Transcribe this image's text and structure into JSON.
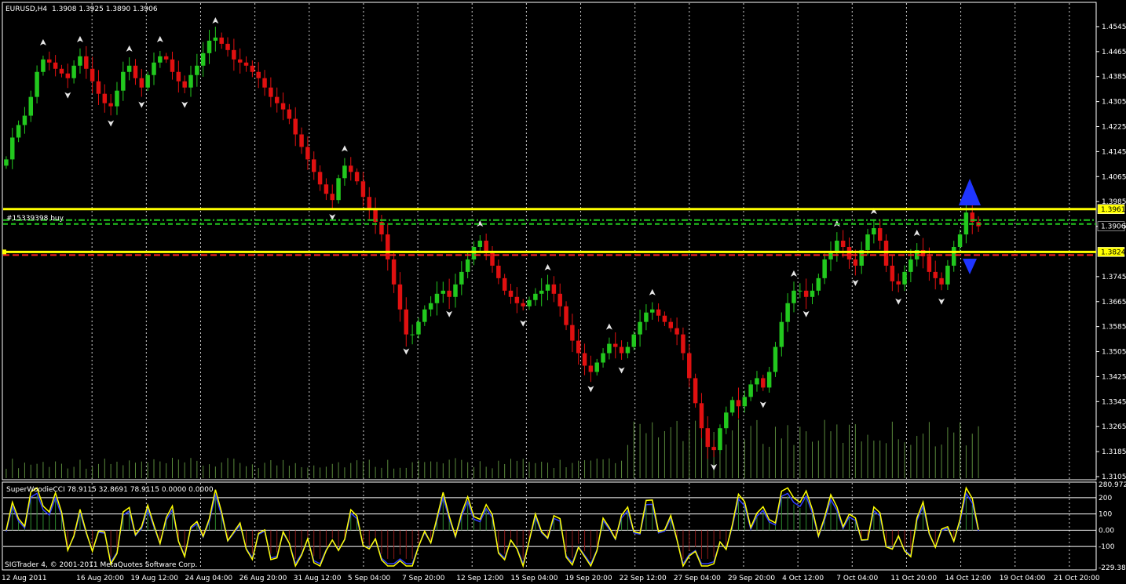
{
  "app": {
    "name": "SIGTrader 4",
    "copyright": "SIGTrader 4, © 2001-2011 MetaQuotes Software Corp."
  },
  "chart_header": {
    "symbol_tf": "EURUSD,H4",
    "ohlc": "1.3908 1.3925 1.3890 1.3906"
  },
  "order_label": "#15339398 buy",
  "price_axis": {
    "ticks": [
      "1.4545",
      "1.4465",
      "1.4385",
      "1.4305",
      "1.4225",
      "1.4145",
      "1.4065",
      "1.3985",
      "1.3906",
      "1.3745",
      "1.3665",
      "1.3585",
      "1.3505",
      "1.3425",
      "1.3345",
      "1.3265",
      "1.3185",
      "1.3105"
    ],
    "markers": {
      "upper": "1.3961",
      "current": "1.3906",
      "lower": "1.3824"
    }
  },
  "time_axis": [
    "12 Aug 2011",
    "16 Aug 20:00",
    "19 Aug 12:00",
    "24 Aug 04:00",
    "26 Aug 20:00",
    "31 Aug 12:00",
    "5 Sep 04:00",
    "7 Sep 20:00",
    "12 Sep 12:00",
    "15 Sep 04:00",
    "19 Sep 20:00",
    "22 Sep 12:00",
    "27 Sep 04:00",
    "29 Sep 20:00",
    "4 Oct 12:00",
    "7 Oct 04:00",
    "11 Oct 20:00",
    "14 Oct 12:00",
    "19 Oct 04:00",
    "21 Oct 20:00"
  ],
  "indicator": {
    "header": "SuperWoodieCCI 78.9115 32.8691 78.9115 0.0000 0.0000",
    "axis": [
      "280.972",
      "200",
      "100",
      "0.00",
      "-100",
      "-229.38"
    ]
  },
  "colors": {
    "bull": "#22c81e",
    "bear": "#e01010",
    "level": "#ffff00",
    "green_line": "#22c81e",
    "red_line": "#ff2020",
    "volume": "#5a8a3c",
    "cci_main": "#ffff00",
    "cci_turbo": "#3040ff",
    "arrow": "#1f35ff"
  },
  "chart_data": {
    "type": "candlestick",
    "symbol": "EURUSD",
    "timeframe": "H4",
    "ylim": [
      1.3105,
      1.4585
    ],
    "levels": {
      "upper": 1.3961,
      "current": 1.3906,
      "lower": 1.3824
    },
    "closes": [
      1.412,
      1.419,
      1.423,
      1.426,
      1.432,
      1.44,
      1.444,
      1.443,
      1.441,
      1.4395,
      1.438,
      1.442,
      1.445,
      1.441,
      1.437,
      1.433,
      1.43,
      1.429,
      1.434,
      1.44,
      1.442,
      1.438,
      1.435,
      1.439,
      1.443,
      1.445,
      1.444,
      1.44,
      1.437,
      1.435,
      1.439,
      1.442,
      1.446,
      1.45,
      1.451,
      1.449,
      1.447,
      1.444,
      1.443,
      1.442,
      1.44,
      1.438,
      1.435,
      1.432,
      1.43,
      1.428,
      1.425,
      1.42,
      1.416,
      1.412,
      1.408,
      1.404,
      1.401,
      1.399,
      1.406,
      1.41,
      1.408,
      1.405,
      1.4,
      1.396,
      1.392,
      1.388,
      1.38,
      1.372,
      1.364,
      1.356,
      1.356,
      1.36,
      1.364,
      1.366,
      1.369,
      1.37,
      1.368,
      1.372,
      1.376,
      1.38,
      1.384,
      1.386,
      1.382,
      1.378,
      1.374,
      1.37,
      1.368,
      1.366,
      1.365,
      1.367,
      1.369,
      1.37,
      1.372,
      1.369,
      1.365,
      1.359,
      1.354,
      1.35,
      1.346,
      1.344,
      1.347,
      1.35,
      1.353,
      1.352,
      1.35,
      1.352,
      1.356,
      1.36,
      1.363,
      1.364,
      1.362,
      1.36,
      1.358,
      1.356,
      1.35,
      1.342,
      1.334,
      1.326,
      1.32,
      1.319,
      1.326,
      1.331,
      1.335,
      1.333,
      1.336,
      1.34,
      1.342,
      1.339,
      1.344,
      1.352,
      1.36,
      1.366,
      1.37,
      1.37,
      1.368,
      1.37,
      1.374,
      1.38,
      1.382,
      1.386,
      1.384,
      1.38,
      1.378,
      1.383,
      1.388,
      1.39,
      1.386,
      1.378,
      1.373,
      1.372,
      1.376,
      1.38,
      1.383,
      1.381,
      1.376,
      1.374,
      1.372,
      1.378,
      1.384,
      1.388,
      1.395,
      1.392,
      1.3906
    ]
  }
}
